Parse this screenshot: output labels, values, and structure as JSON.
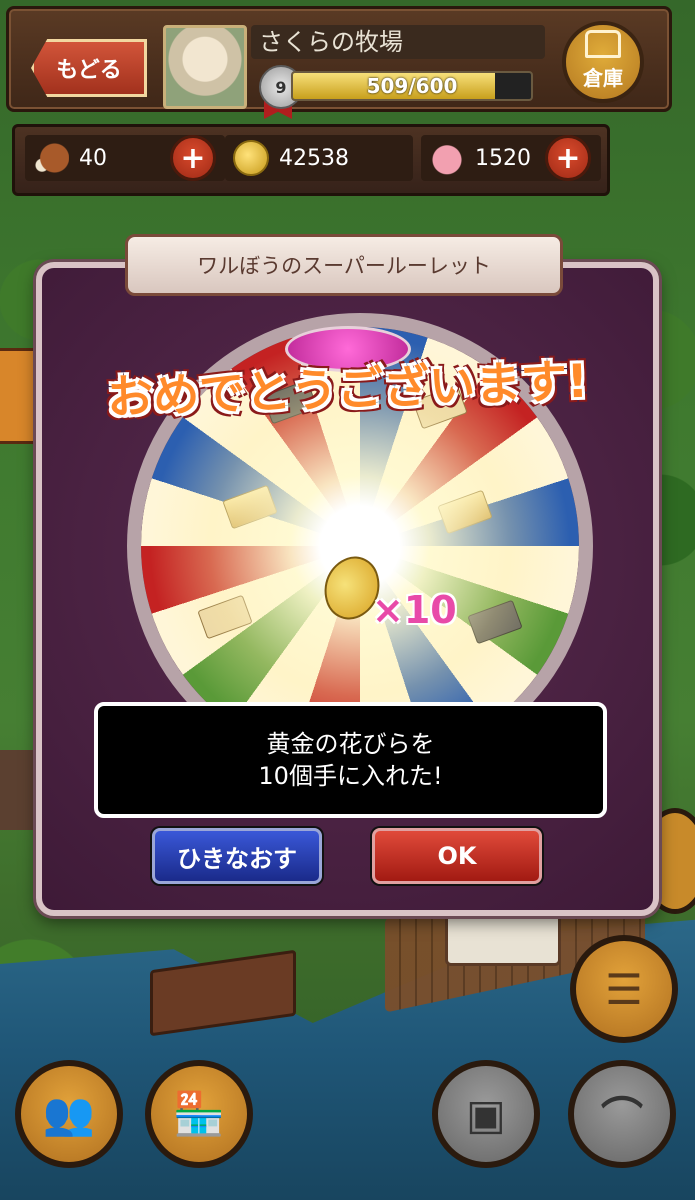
{
  "header": {
    "back_label": "もどる",
    "farm_name": "さくらの牧場",
    "level": "9",
    "xp_text": "509/600",
    "xp_fraction": 0.848,
    "warehouse_label": "倉庫"
  },
  "resources": {
    "meat": "40",
    "coins": "42538",
    "gems": "1520",
    "plus_label": "+"
  },
  "modal": {
    "title": "ワルぼうのスーパールーレット",
    "congrats": "おめでとうございます!",
    "reward_qty": "×10",
    "message_line1": "黄金の花びらを",
    "message_line2": "10個手に入れた!",
    "retry_label": "ひきなおす",
    "ok_label": "OK"
  },
  "colors": {
    "accent_orange": "#ff8a2a",
    "modal_purple": "#4a1f42",
    "retry_blue": "#2a3fb0",
    "ok_red": "#c42a1c"
  },
  "icons": {
    "bottom_left_1": "friends-icon",
    "bottom_left_2": "shop-icon",
    "bottom_right_1": "storage-box-icon",
    "bottom_right_2": "sickle-icon",
    "right_side": "list-icon"
  }
}
